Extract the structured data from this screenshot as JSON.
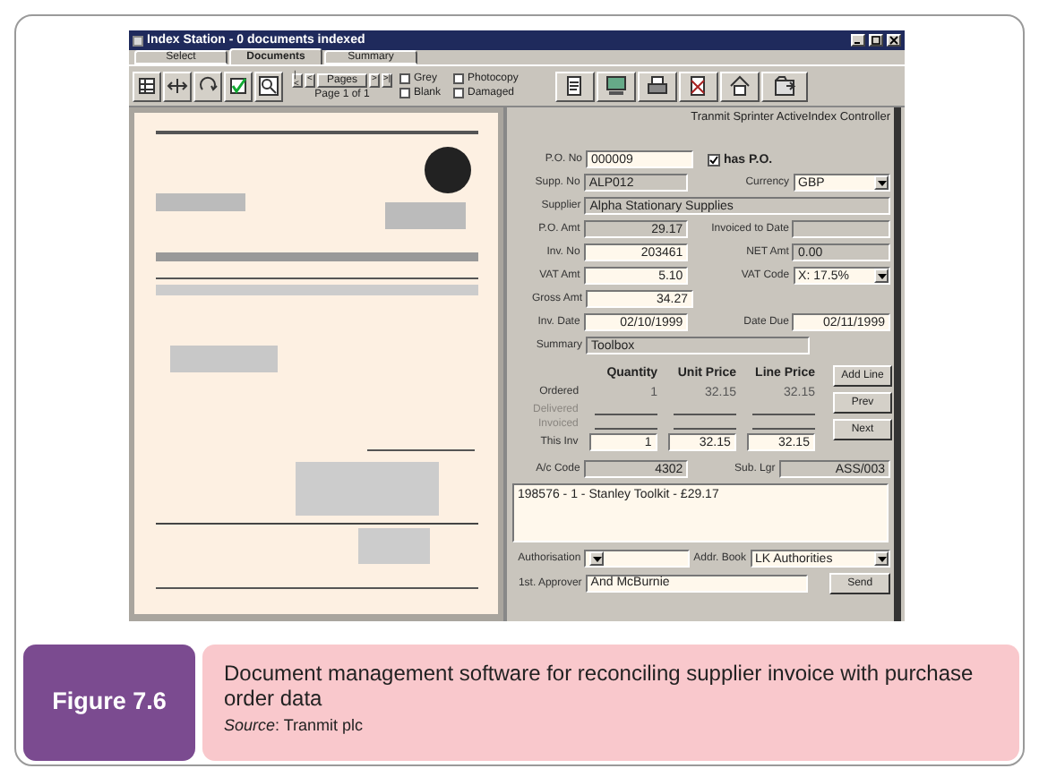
{
  "window": {
    "title": "Index Station - 0 documents indexed"
  },
  "tabs": [
    {
      "label": "Select",
      "selected": false
    },
    {
      "label": "Documents",
      "selected": true
    },
    {
      "label": "Summary",
      "selected": false
    }
  ],
  "pager": {
    "nav": [
      "|<",
      "<",
      ">",
      ">|"
    ],
    "label": "Pages",
    "status": "Page 1 of 1"
  },
  "flags": [
    {
      "label": "Grey",
      "checked": false
    },
    {
      "label": "Photocopy",
      "checked": false
    },
    {
      "label": "Blank",
      "checked": false
    },
    {
      "label": "Damaged",
      "checked": false
    }
  ],
  "controller_title": "Tranmit Sprinter ActiveIndex Controller",
  "form_rows": [
    {
      "fields": [
        {
          "label": "P.O. No",
          "value": "000009",
          "kind": "input",
          "numeric": false
        },
        {
          "label": "has P.O.",
          "kind": "checkbox",
          "checked": true
        }
      ]
    },
    {
      "fields": [
        {
          "label": "Supp. No",
          "value": "ALP012",
          "kind": "readonly",
          "numeric": false
        },
        {
          "label": "Currency",
          "value": "GBP",
          "kind": "select"
        }
      ]
    },
    {
      "fields": [
        {
          "label": "Supplier",
          "value": "Alpha Stationary Supplies",
          "kind": "long_readonly"
        }
      ]
    },
    {
      "fields": [
        {
          "label": "P.O. Amt",
          "value": "29.17",
          "kind": "readonly",
          "numeric": true
        },
        {
          "label": "Invoiced to Date",
          "kind": "readonly"
        }
      ]
    },
    {
      "fields": [
        {
          "label": "Inv. No",
          "value": "203461",
          "kind": "input",
          "numeric": true
        },
        {
          "label": "NET Amt",
          "value": "0.00",
          "kind": "readonly",
          "numeric": false
        }
      ]
    },
    {
      "fields": [
        {
          "label": "VAT Amt",
          "value": "5.10",
          "kind": "input",
          "numeric": true
        },
        {
          "label": "VAT Code",
          "value": "X: 17.5%",
          "kind": "select"
        }
      ]
    },
    {
      "fields": [
        {
          "label": "Gross Amt",
          "value": "34.27",
          "kind": "input",
          "numeric": true
        }
      ]
    },
    {
      "fields": [
        {
          "label": "Inv. Date",
          "value": "02/10/1999",
          "kind": "input",
          "numeric": true
        },
        {
          "label": "Date Due",
          "value": "02/11/1999",
          "kind": "input",
          "numeric": true
        }
      ]
    },
    {
      "fields": [
        {
          "label": "Summary",
          "value": "Toolbox",
          "kind": "long_readonly"
        }
      ]
    }
  ],
  "lines": {
    "columns": [
      "Quantity",
      "Unit Price",
      "Line Price"
    ],
    "rows": [
      {
        "label": "Ordered",
        "kind": "text",
        "disabled": false,
        "values": [
          "1",
          "32.15",
          "32.15"
        ]
      },
      {
        "label": "Delivered",
        "kind": "blank",
        "disabled": true
      },
      {
        "label": "Invoiced",
        "kind": "blank",
        "disabled": true
      },
      {
        "label": "This Inv",
        "kind": "input",
        "disabled": false,
        "values": [
          "1",
          "32.15",
          "32.15"
        ]
      }
    ],
    "buttons": [
      "Add Line",
      "Prev",
      "Next"
    ]
  },
  "account_row": [
    {
      "label": "A/c Code",
      "value": "4302"
    },
    {
      "label": "Sub. Lgr",
      "value": "ASS/003"
    }
  ],
  "memo": "198576 - 1 - Stanley Toolkit - £29.17",
  "authorisation": {
    "label": "Authorisation"
  },
  "address_book": {
    "label": "Addr. Book",
    "value": "LK Authorities"
  },
  "approver": {
    "label": "1st. Approver",
    "value": "And McBurnie"
  },
  "send_button": "Send",
  "caption": {
    "figure": "Figure 7.6",
    "text": "Document management software for reconciling supplier invoice with purchase order data",
    "source": "*Source*: Tranmit plc"
  }
}
